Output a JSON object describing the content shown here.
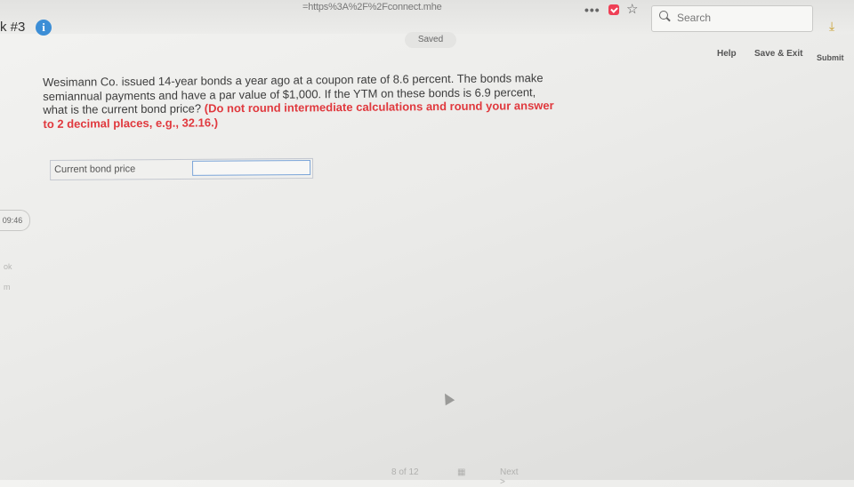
{
  "browser": {
    "url_fragment": "=https%3A%2F%2Fconnect.mhe",
    "overflow_menu": "•••",
    "search_placeholder": "Search"
  },
  "header": {
    "question_number": "k #3",
    "info_glyph": "i",
    "saved_label": "Saved",
    "help_label": "Help",
    "save_exit_label": "Save & Exit",
    "submit_label": "Submit"
  },
  "question": {
    "body": "Wesimann Co. issued 14-year bonds a year ago at a coupon rate of 8.6 percent. The bonds make semiannual payments and have a par value of $1,000. If the YTM on these bonds is 6.9 percent, what is the current bond price?",
    "instruction": "(Do not round intermediate calculations and round your answer to 2 decimal places, e.g., 32.16.)"
  },
  "answer": {
    "label": "Current bond price",
    "value": ""
  },
  "timer": {
    "value": "09:46"
  },
  "sidebar": {
    "item1": "ok",
    "item2": "m"
  },
  "footer": {
    "page_text": "8 of 12",
    "next_label": "Next >"
  },
  "colors": {
    "accent_red": "#e0393e",
    "info_blue": "#3c8ed6",
    "pocket_red": "#ef4056"
  }
}
